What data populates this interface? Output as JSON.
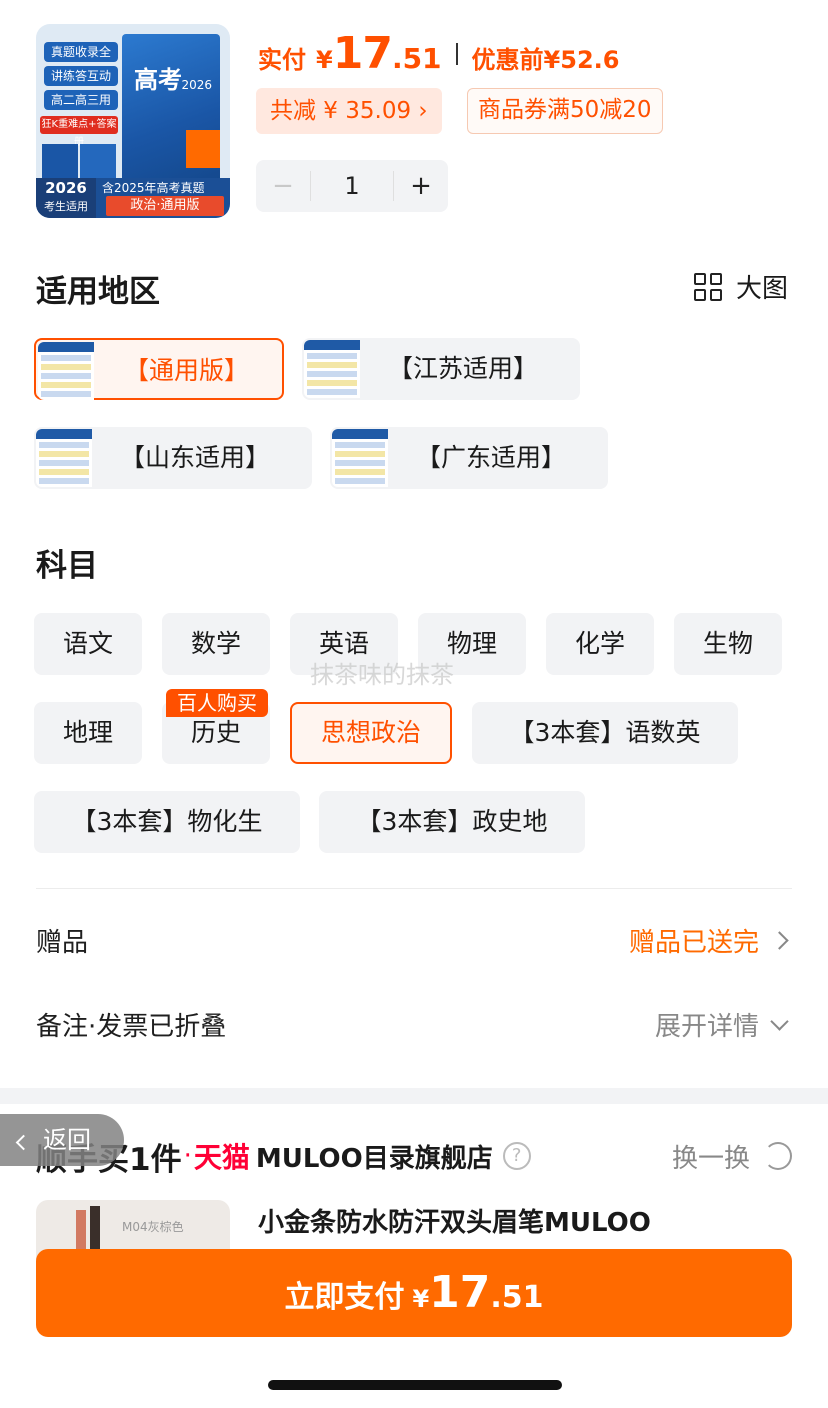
{
  "product": {
    "thumb_tags": [
      "真题收录全",
      "讲练答互动",
      "高二高三用"
    ],
    "thumb_book_title": "高考",
    "thumb_book_year": "2026",
    "thumb_red_tag": "狂K重难点+答案册",
    "thumb_year_big": "2026",
    "thumb_year_sub": "考生适用",
    "thumb_bar_text": "含2025年高考真题",
    "thumb_bar_sub": "政治·通用版",
    "price_label": "实付",
    "currency": "¥",
    "price_int": "17",
    "price_dec": ".51",
    "orig_label": "优惠前",
    "orig_price": "¥52.6",
    "discount_text": "共减 ¥ 35.09 ›",
    "coupon_text": "商品券满50减20",
    "quantity": "1",
    "minus": "−",
    "plus": "+"
  },
  "region": {
    "title": "适用地区",
    "big_view": "大图",
    "options": [
      "【通用版】",
      "【江苏适用】",
      "【山东适用】",
      "【广东适用】"
    ],
    "selected": "【通用版】"
  },
  "subject": {
    "title": "科目",
    "options": [
      "语文",
      "数学",
      "英语",
      "物理",
      "化学",
      "生物",
      "地理",
      "历史",
      "思想政治",
      "【3本套】语数英",
      "【3本套】物化生",
      "【3本套】政史地"
    ],
    "selected": "思想政治",
    "hot_badge": "百人购买"
  },
  "watermark": "抹茶味的抹茶",
  "gift": {
    "label": "赠品",
    "value": "赠品已送完"
  },
  "note": {
    "label": "备注·发票已折叠",
    "value": "展开详情"
  },
  "recommend": {
    "buy_label": "顺手买1件",
    "dot": "·",
    "tmall": "天猫",
    "shop_name": "MULOO目录旗舰店",
    "help": "?",
    "swap": "换一换",
    "item_title": "小金条防水防汗双头眉笔MULOO",
    "thumb_text": "M04灰棕色"
  },
  "back_label": "返回",
  "pay": {
    "label": "立即支付",
    "currency": "¥",
    "int": "17",
    "dec": ".51"
  },
  "colors": {
    "accent": "#ff5000",
    "pay_button": "#ff6a00",
    "tmall": "#ff0036",
    "chip_bg": "#f2f3f5"
  }
}
